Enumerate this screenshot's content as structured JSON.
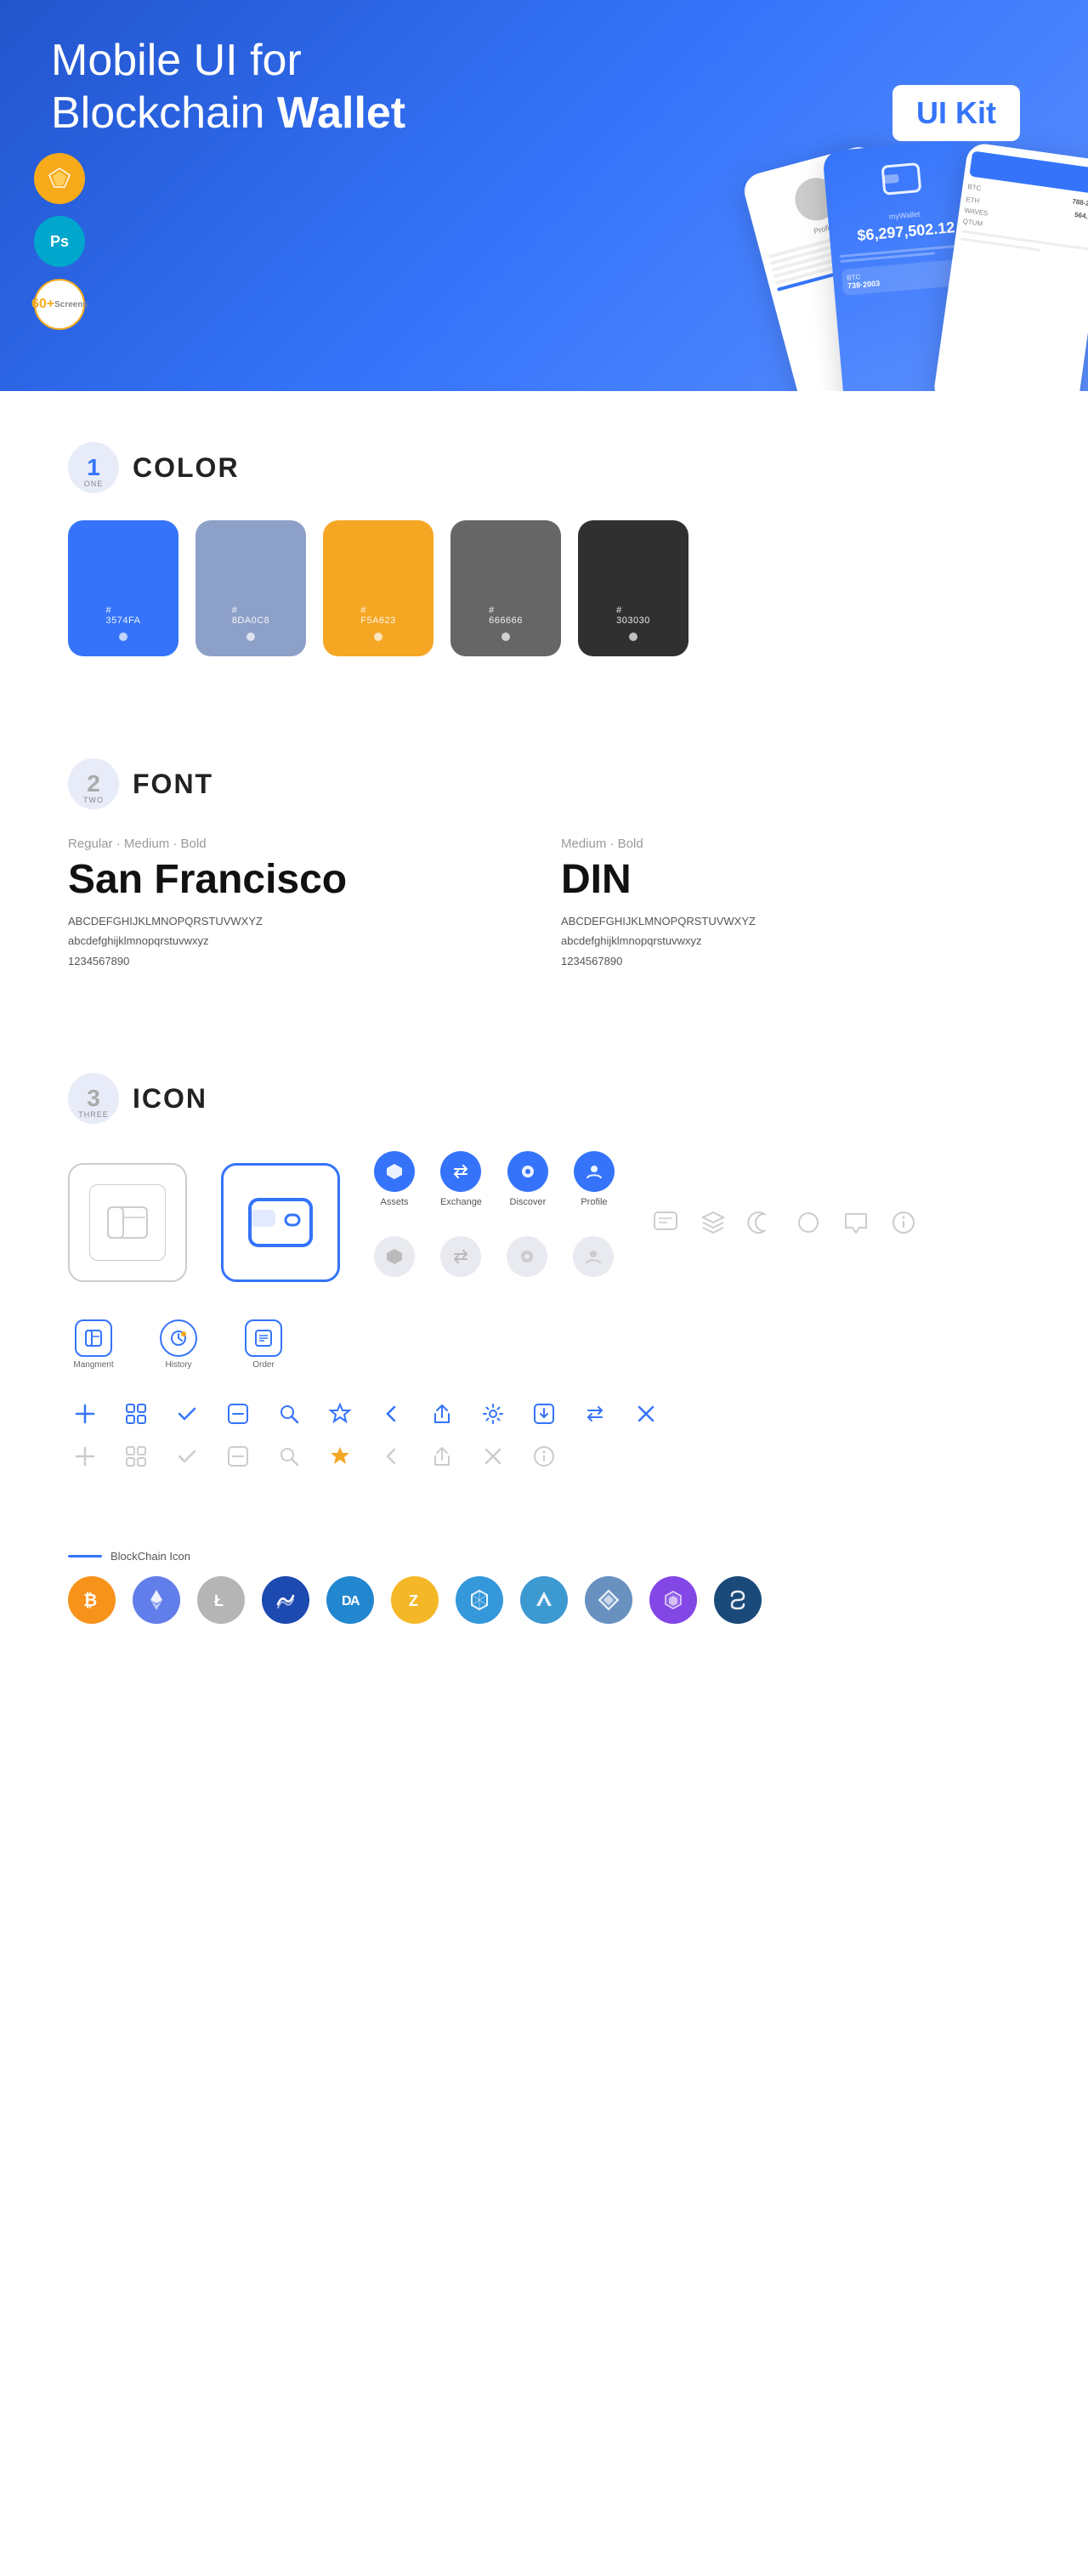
{
  "hero": {
    "title_part1": "Mobile UI for Blockchain ",
    "title_bold": "Wallet",
    "badge": "UI Kit",
    "sketch_label": "Sk",
    "ps_label": "Ps",
    "screens_line1": "60+",
    "screens_line2": "Screens"
  },
  "sections": {
    "color": {
      "num": "1",
      "num_label": "ONE",
      "title": "COLOR",
      "swatches": [
        {
          "hex": "#3574FA",
          "label": "#\n3574FA",
          "id": "blue"
        },
        {
          "hex": "#8DA0C8",
          "label": "#\n8DA0C8",
          "id": "grayblue"
        },
        {
          "hex": "#F5A623",
          "label": "#\nF5A623",
          "id": "orange"
        },
        {
          "hex": "#666666",
          "label": "#\n666666",
          "id": "gray"
        },
        {
          "hex": "#303030",
          "label": "#\n303030",
          "id": "dark"
        }
      ]
    },
    "font": {
      "num": "2",
      "num_label": "TWO",
      "title": "FONT",
      "fonts": [
        {
          "style": "Regular · Medium · Bold",
          "name": "San Francisco",
          "uppercase": "ABCDEFGHIJKLMNOPQRSTUVWXYZ",
          "lowercase": "abcdefghijklmnopqrstuvwxyz",
          "numbers": "1234567890"
        },
        {
          "style": "Medium · Bold",
          "name": "DIN",
          "uppercase": "ABCDEFGHIJKLMNOPQRSTUVWXYZ",
          "lowercase": "abcdefghijklmnopqrstuvwxyz",
          "numbers": "1234567890"
        }
      ]
    },
    "icon": {
      "num": "3",
      "num_label": "THREE",
      "title": "ICON",
      "labeled_icons": [
        {
          "label": "Assets",
          "type": "blue-circle",
          "icon": "◆"
        },
        {
          "label": "Exchange",
          "type": "blue-circle",
          "icon": "⇄"
        },
        {
          "label": "Discover",
          "type": "blue-circle",
          "icon": "●"
        },
        {
          "label": "Profile",
          "type": "blue-circle",
          "icon": "👤"
        }
      ],
      "bottom_icons": [
        {
          "label": "Mangment",
          "type": "blue-square",
          "icon": "▭"
        },
        {
          "label": "History",
          "type": "blue-circle-outline",
          "icon": "⏱"
        },
        {
          "label": "Order",
          "type": "blue-square",
          "icon": "≡"
        }
      ],
      "misc_icons": [
        "+",
        "⊞",
        "✓",
        "⊟",
        "🔍",
        "☆",
        "‹",
        "⟨",
        "⚙",
        "⊡",
        "⇌",
        "✕"
      ]
    },
    "blockchain": {
      "line_label": "BlockChain Icon",
      "coins": [
        {
          "symbol": "₿",
          "class": "coin-btc",
          "name": "Bitcoin"
        },
        {
          "symbol": "Ξ",
          "class": "coin-eth",
          "name": "Ethereum"
        },
        {
          "symbol": "Ł",
          "class": "coin-ltc",
          "name": "Litecoin"
        },
        {
          "symbol": "W",
          "class": "coin-waves",
          "name": "Waves"
        },
        {
          "symbol": "D",
          "class": "coin-dash",
          "name": "Dash"
        },
        {
          "symbol": "Z",
          "class": "coin-zcash",
          "name": "Zcash"
        },
        {
          "symbol": "G",
          "class": "coin-grid",
          "name": "Grid"
        },
        {
          "symbol": "L",
          "class": "coin-lisk",
          "name": "Lisk"
        },
        {
          "symbol": "N",
          "class": "coin-nem",
          "name": "NEM"
        },
        {
          "symbol": "M",
          "class": "coin-matic",
          "name": "Matic"
        },
        {
          "symbol": "S",
          "class": "coin-skl",
          "name": "Skale"
        }
      ]
    }
  }
}
